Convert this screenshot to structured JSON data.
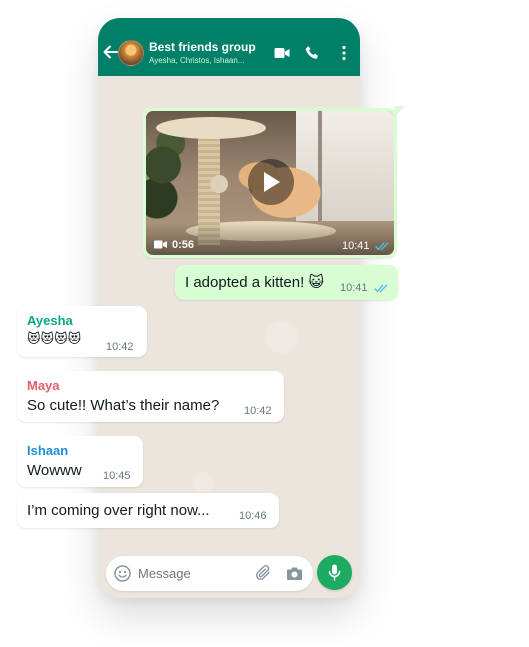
{
  "colors": {
    "header": "#008069",
    "outgoing_bubble": "#d9fdd3",
    "incoming_bubble": "#ffffff",
    "read_ticks": "#53bdeb",
    "mic_button": "#1daa61"
  },
  "header": {
    "title": "Best friends group",
    "subtitle": "Ayesha, Christos, Ishaan...",
    "icons": [
      "back-arrow-icon",
      "group-avatar",
      "video-call-icon",
      "voice-call-icon",
      "more-options-icon"
    ]
  },
  "messages": [
    {
      "type": "video",
      "direction": "outgoing",
      "duration": "0:56",
      "time": "10:41",
      "status": "read"
    },
    {
      "type": "text",
      "direction": "outgoing",
      "text": "I adopted a kitten! 😺",
      "time": "10:41",
      "status": "read"
    },
    {
      "type": "text",
      "direction": "incoming",
      "sender": "Ayesha",
      "sender_color": "#06a884",
      "text": "😻😻😻😻",
      "time": "10:42"
    },
    {
      "type": "text",
      "direction": "incoming",
      "sender": "Maya",
      "sender_color": "#e2606a",
      "text": "So cute!! What’s their name?",
      "time": "10:42"
    },
    {
      "type": "text",
      "direction": "incoming",
      "sender": "Ishaan",
      "sender_color": "#1f8fd9",
      "text": "Wowww",
      "time": "10:45"
    },
    {
      "type": "text",
      "direction": "incoming",
      "text": "I’m coming over right now...",
      "time": "10:46"
    }
  ],
  "composer": {
    "placeholder": "Message",
    "icons": [
      "emoji-icon",
      "attach-icon",
      "camera-icon",
      "mic-icon"
    ]
  }
}
